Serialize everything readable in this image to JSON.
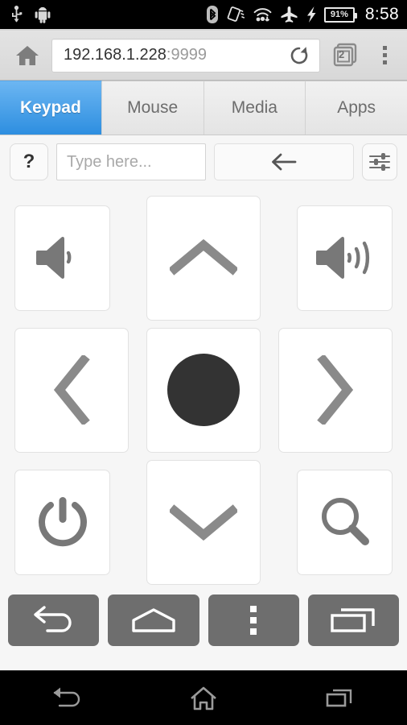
{
  "statusbar": {
    "left_icons": [
      "usb-icon",
      "android-icon"
    ],
    "right_icons": [
      "bluetooth-icon",
      "auto-rotate-icon",
      "wifi-icon",
      "airplane-mode-icon",
      "charging-bolt-icon"
    ],
    "battery_percent": "91%",
    "clock": "8:58"
  },
  "browser": {
    "home_icon": "home-icon",
    "url_host": "192.168.1.228",
    "url_port": ":9999",
    "reload_icon": "reload-icon",
    "tab_count": "2",
    "overflow_icon": "overflow-menu-icon"
  },
  "tabs": [
    {
      "label": "Keypad",
      "active": true
    },
    {
      "label": "Mouse",
      "active": false
    },
    {
      "label": "Media",
      "active": false
    },
    {
      "label": "Apps",
      "active": false
    }
  ],
  "toolbar": {
    "help_label": "?",
    "input_placeholder": "Type here...",
    "input_value": "",
    "back_icon": "arrow-left-icon",
    "settings_icon": "sliders-icon"
  },
  "keypad": {
    "rows": [
      [
        {
          "name": "volume-down-button",
          "icon": "speaker-low-icon",
          "size": "small"
        },
        {
          "name": "dpad-up-button",
          "icon": "chevron-up-icon",
          "size": "big"
        },
        {
          "name": "volume-up-button",
          "icon": "speaker-high-icon",
          "size": "small"
        }
      ],
      [
        {
          "name": "dpad-left-button",
          "icon": "chevron-left-icon",
          "size": "big"
        },
        {
          "name": "dpad-ok-button",
          "icon": "filled-circle-icon",
          "size": "big"
        },
        {
          "name": "dpad-right-button",
          "icon": "chevron-right-icon",
          "size": "big"
        }
      ],
      [
        {
          "name": "power-button",
          "icon": "power-icon",
          "size": "small"
        },
        {
          "name": "dpad-down-button",
          "icon": "chevron-down-icon",
          "size": "big"
        },
        {
          "name": "search-button",
          "icon": "magnifier-icon",
          "size": "small"
        }
      ]
    ]
  },
  "actionbar": [
    {
      "name": "nav-back-button",
      "icon": "back-arrow-icon"
    },
    {
      "name": "nav-home-button",
      "icon": "home-outline-icon"
    },
    {
      "name": "nav-menu-button",
      "icon": "three-dots-icon"
    },
    {
      "name": "nav-recents-button",
      "icon": "recents-icon"
    }
  ],
  "sysnav": [
    {
      "name": "system-back-button",
      "icon": "system-back-icon"
    },
    {
      "name": "system-home-button",
      "icon": "system-home-icon"
    },
    {
      "name": "system-recents-button",
      "icon": "system-recents-icon"
    }
  ],
  "colors": {
    "accent_blue": "#2d8ee0",
    "icon_gray": "#787878",
    "dark_circle": "#333333",
    "action_gray": "#6e6e6e",
    "page_bg": "#f6f6f6"
  }
}
